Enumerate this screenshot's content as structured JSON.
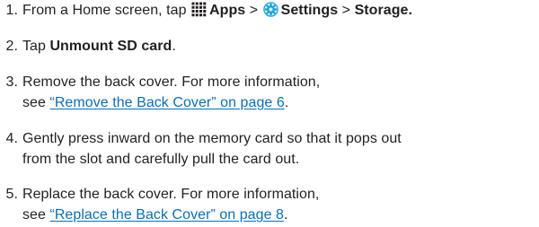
{
  "steps": [
    {
      "number": "1.",
      "parts": {
        "intro": "From a Home screen, tap ",
        "apps_label": "Apps",
        "sep1": " > ",
        "settings_label": "Settings",
        "sep2": " > ",
        "storage_label": "Storage."
      },
      "icons": [
        "apps-grid-icon",
        "settings-gear-icon"
      ]
    },
    {
      "number": "2.",
      "parts": {
        "intro": "Tap ",
        "bold": "Unmount SD card",
        "end": "."
      }
    },
    {
      "number": "3.",
      "line1": "Remove the back cover. For more information,",
      "line2_prefix": "see ",
      "link": "“Remove the Back Cover” on page 6",
      "line2_suffix": "."
    },
    {
      "number": "4.",
      "line1": "Gently press inward on the memory card so that it pops out",
      "line2": "from the slot and carefully pull the card out."
    },
    {
      "number": "5.",
      "line1": "Replace the back cover. For more information,",
      "line2_prefix": "see ",
      "link": "“Replace the Back Cover” on page 8",
      "line2_suffix": "."
    }
  ],
  "colors": {
    "text": "#231f20",
    "link": "#0a6fb5",
    "settings_icon": "#1aa3d9"
  }
}
